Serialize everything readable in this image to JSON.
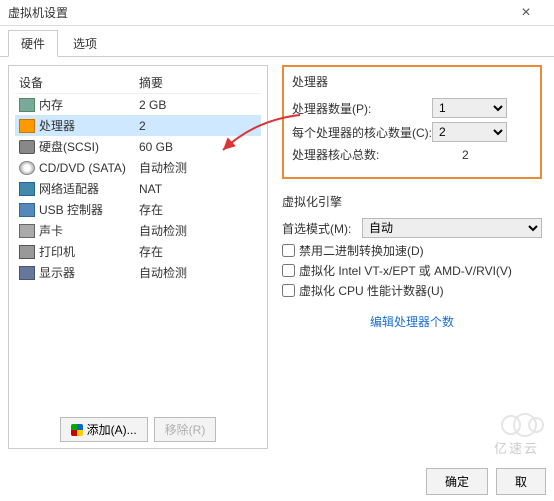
{
  "window": {
    "title": "虚拟机设置",
    "close": "×"
  },
  "tabs": {
    "hardware": "硬件",
    "options": "选项"
  },
  "hw_header": {
    "device": "设备",
    "summary": "摘要"
  },
  "hw": [
    {
      "icon": "ic-mem",
      "name": "内存",
      "summary": "2 GB"
    },
    {
      "icon": "ic-cpu",
      "name": "处理器",
      "summary": "2",
      "selected": true
    },
    {
      "icon": "ic-disk",
      "name": "硬盘(SCSI)",
      "summary": "60 GB"
    },
    {
      "icon": "ic-cd",
      "name": "CD/DVD (SATA)",
      "summary": "自动检测"
    },
    {
      "icon": "ic-net",
      "name": "网络适配器",
      "summary": "NAT"
    },
    {
      "icon": "ic-usb",
      "name": "USB 控制器",
      "summary": "存在"
    },
    {
      "icon": "ic-snd",
      "name": "声卡",
      "summary": "自动检测"
    },
    {
      "icon": "ic-prn",
      "name": "打印机",
      "summary": "存在"
    },
    {
      "icon": "ic-disp",
      "name": "显示器",
      "summary": "自动检测"
    }
  ],
  "left_buttons": {
    "add": "添加(A)...",
    "remove": "移除(R)"
  },
  "proc": {
    "group_title": "处理器",
    "count_label": "处理器数量(P):",
    "count_value": "1",
    "cores_label": "每个处理器的核心数量(C):",
    "cores_value": "2",
    "total_label": "处理器核心总数:",
    "total_value": "2"
  },
  "virt": {
    "group_title": "虚拟化引擎",
    "pref_label": "首选模式(M):",
    "pref_value": "自动",
    "cb1": "禁用二进制转换加速(D)",
    "cb2": "虚拟化 Intel VT-x/EPT 或 AMD-V/RVI(V)",
    "cb3": "虚拟化 CPU 性能计数器(U)"
  },
  "link": "编辑处理器个数",
  "footer": {
    "ok": "确定",
    "cancel": "取"
  },
  "watermark": "亿速云"
}
